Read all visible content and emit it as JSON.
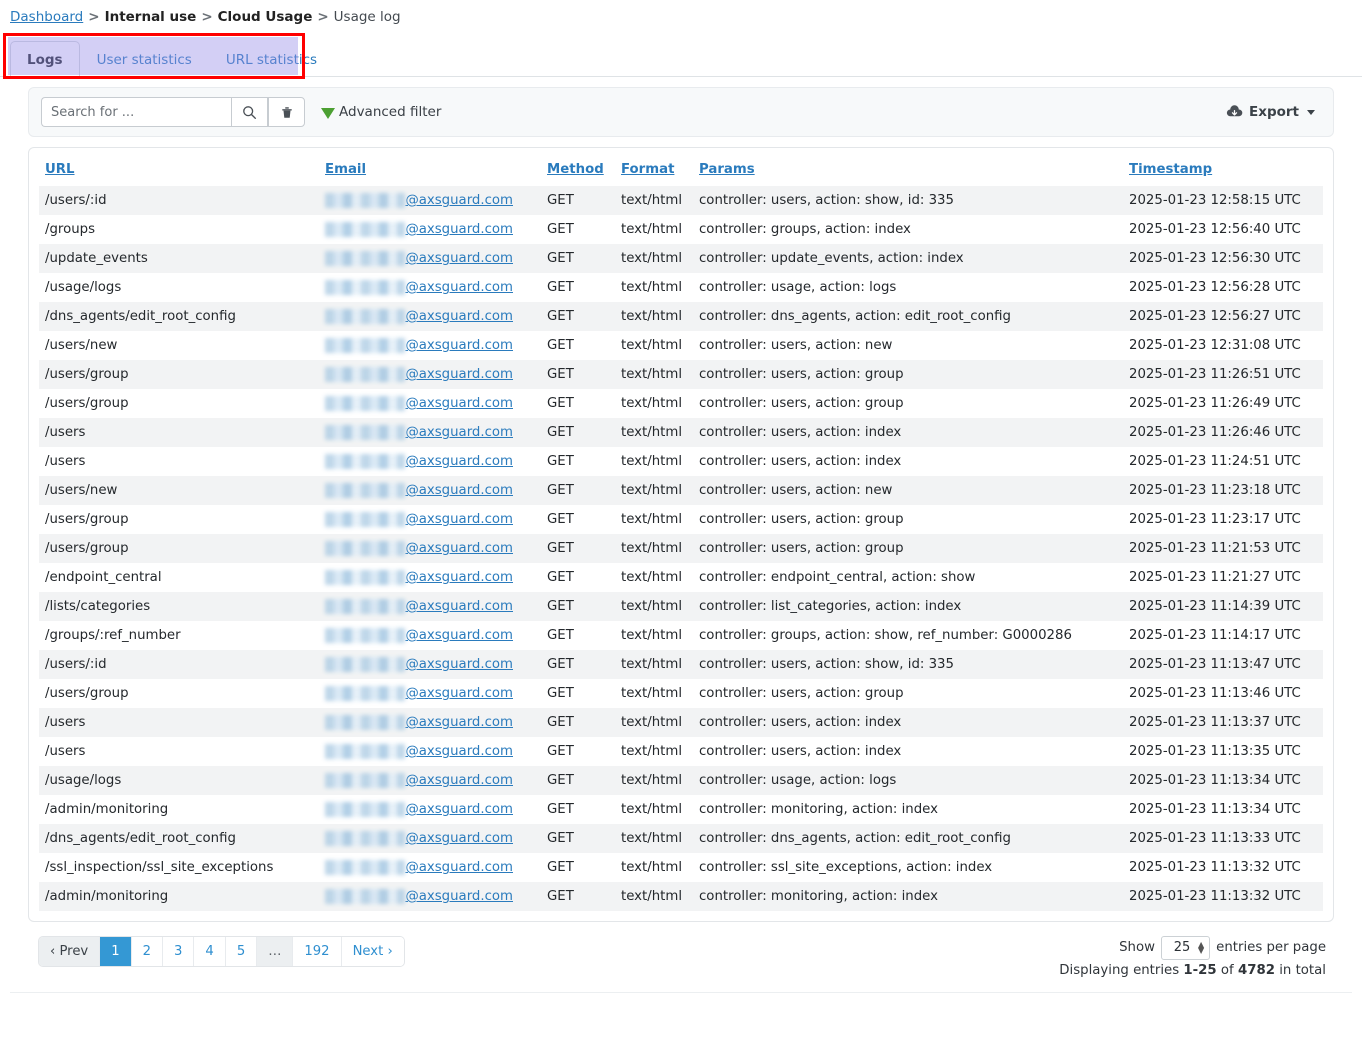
{
  "breadcrumb": {
    "items": [
      {
        "label": "Dashboard",
        "type": "link"
      },
      {
        "label": "Internal use",
        "type": "strong"
      },
      {
        "label": "Cloud Usage",
        "type": "strong"
      },
      {
        "label": "Usage log",
        "type": "text"
      }
    ],
    "separator": ">"
  },
  "tabs": [
    {
      "label": "Logs",
      "active": true
    },
    {
      "label": "User statistics",
      "active": false
    },
    {
      "label": "URL statistics",
      "active": false
    }
  ],
  "toolbar": {
    "search_value": "",
    "search_placeholder": "Search for ...",
    "search_icon": "search-icon",
    "clear_icon": "trash-icon",
    "advanced_filter_label": "Advanced filter",
    "filter_icon": "funnel-icon",
    "export_label": "Export",
    "export_icon": "cloud-download-icon",
    "export_caret": "chevron-down-icon"
  },
  "table": {
    "columns": [
      {
        "key": "url",
        "label": "URL"
      },
      {
        "key": "email",
        "label": "Email"
      },
      {
        "key": "method",
        "label": "Method"
      },
      {
        "key": "format",
        "label": "Format"
      },
      {
        "key": "params",
        "label": "Params"
      },
      {
        "key": "timestamp",
        "label": "Timestamp"
      }
    ],
    "email_domain": "@axsguard.com",
    "rows": [
      {
        "url": "/users/:id",
        "method": "GET",
        "format": "text/html",
        "params": "controller: users, action: show, id: 335",
        "timestamp": "2025-01-23 12:58:15 UTC"
      },
      {
        "url": "/groups",
        "method": "GET",
        "format": "text/html",
        "params": "controller: groups, action: index",
        "timestamp": "2025-01-23 12:56:40 UTC"
      },
      {
        "url": "/update_events",
        "method": "GET",
        "format": "text/html",
        "params": "controller: update_events, action: index",
        "timestamp": "2025-01-23 12:56:30 UTC"
      },
      {
        "url": "/usage/logs",
        "method": "GET",
        "format": "text/html",
        "params": "controller: usage, action: logs",
        "timestamp": "2025-01-23 12:56:28 UTC"
      },
      {
        "url": "/dns_agents/edit_root_config",
        "method": "GET",
        "format": "text/html",
        "params": "controller: dns_agents, action: edit_root_config",
        "timestamp": "2025-01-23 12:56:27 UTC"
      },
      {
        "url": "/users/new",
        "method": "GET",
        "format": "text/html",
        "params": "controller: users, action: new",
        "timestamp": "2025-01-23 12:31:08 UTC"
      },
      {
        "url": "/users/group",
        "method": "GET",
        "format": "text/html",
        "params": "controller: users, action: group",
        "timestamp": "2025-01-23 11:26:51 UTC"
      },
      {
        "url": "/users/group",
        "method": "GET",
        "format": "text/html",
        "params": "controller: users, action: group",
        "timestamp": "2025-01-23 11:26:49 UTC"
      },
      {
        "url": "/users",
        "method": "GET",
        "format": "text/html",
        "params": "controller: users, action: index",
        "timestamp": "2025-01-23 11:26:46 UTC"
      },
      {
        "url": "/users",
        "method": "GET",
        "format": "text/html",
        "params": "controller: users, action: index",
        "timestamp": "2025-01-23 11:24:51 UTC"
      },
      {
        "url": "/users/new",
        "method": "GET",
        "format": "text/html",
        "params": "controller: users, action: new",
        "timestamp": "2025-01-23 11:23:18 UTC"
      },
      {
        "url": "/users/group",
        "method": "GET",
        "format": "text/html",
        "params": "controller: users, action: group",
        "timestamp": "2025-01-23 11:23:17 UTC"
      },
      {
        "url": "/users/group",
        "method": "GET",
        "format": "text/html",
        "params": "controller: users, action: group",
        "timestamp": "2025-01-23 11:21:53 UTC"
      },
      {
        "url": "/endpoint_central",
        "method": "GET",
        "format": "text/html",
        "params": "controller: endpoint_central, action: show",
        "timestamp": "2025-01-23 11:21:27 UTC"
      },
      {
        "url": "/lists/categories",
        "method": "GET",
        "format": "text/html",
        "params": "controller: list_categories, action: index",
        "timestamp": "2025-01-23 11:14:39 UTC"
      },
      {
        "url": "/groups/:ref_number",
        "method": "GET",
        "format": "text/html",
        "params": "controller: groups, action: show, ref_number: G0000286",
        "timestamp": "2025-01-23 11:14:17 UTC"
      },
      {
        "url": "/users/:id",
        "method": "GET",
        "format": "text/html",
        "params": "controller: users, action: show, id: 335",
        "timestamp": "2025-01-23 11:13:47 UTC"
      },
      {
        "url": "/users/group",
        "method": "GET",
        "format": "text/html",
        "params": "controller: users, action: group",
        "timestamp": "2025-01-23 11:13:46 UTC"
      },
      {
        "url": "/users",
        "method": "GET",
        "format": "text/html",
        "params": "controller: users, action: index",
        "timestamp": "2025-01-23 11:13:37 UTC"
      },
      {
        "url": "/users",
        "method": "GET",
        "format": "text/html",
        "params": "controller: users, action: index",
        "timestamp": "2025-01-23 11:13:35 UTC"
      },
      {
        "url": "/usage/logs",
        "method": "GET",
        "format": "text/html",
        "params": "controller: usage, action: logs",
        "timestamp": "2025-01-23 11:13:34 UTC"
      },
      {
        "url": "/admin/monitoring",
        "method": "GET",
        "format": "text/html",
        "params": "controller: monitoring, action: index",
        "timestamp": "2025-01-23 11:13:34 UTC"
      },
      {
        "url": "/dns_agents/edit_root_config",
        "method": "GET",
        "format": "text/html",
        "params": "controller: dns_agents, action: edit_root_config",
        "timestamp": "2025-01-23 11:13:33 UTC"
      },
      {
        "url": "/ssl_inspection/ssl_site_exceptions",
        "method": "GET",
        "format": "text/html",
        "params": "controller: ssl_site_exceptions, action: index",
        "timestamp": "2025-01-23 11:13:32 UTC"
      },
      {
        "url": "/admin/monitoring",
        "method": "GET",
        "format": "text/html",
        "params": "controller: monitoring, action: index",
        "timestamp": "2025-01-23 11:13:32 UTC"
      }
    ]
  },
  "pagination": {
    "prev_label": "‹ Prev",
    "next_label": "Next ›",
    "pages": [
      "1",
      "2",
      "3",
      "4",
      "5",
      "…",
      "192"
    ],
    "active_page": "1",
    "show_label": "Show",
    "per_page_value": "25",
    "entries_suffix": "entries per page",
    "displaying_prefix": "Displaying entries",
    "range": "1-25",
    "of_word": "of",
    "total": "4782",
    "total_suffix": "in total"
  },
  "colors": {
    "link": "#2a7bbd",
    "accent": "#3498d4",
    "funnel_green": "#4ca032",
    "highlight_box": "#ff0000",
    "tab_highlight": "#968ce6"
  }
}
